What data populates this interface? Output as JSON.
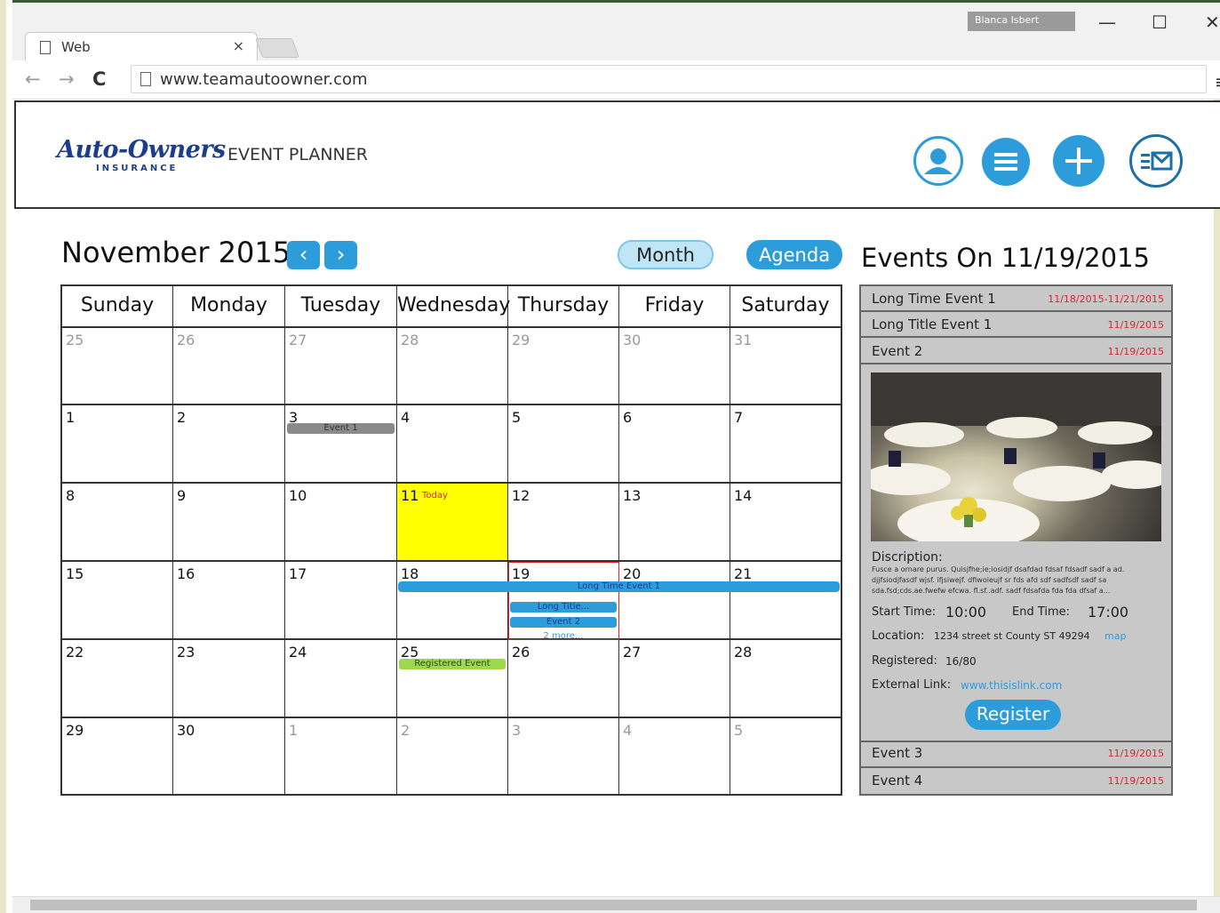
{
  "browser": {
    "tab_title": "Web",
    "tab_close": "×",
    "user_badge": "Blanca Isbert",
    "minimize": "—",
    "maximize": "☐",
    "close": "✕",
    "url": "www.teamautoowner.com",
    "back": "←",
    "forward": "→",
    "reload": "C",
    "menu": "≡"
  },
  "header": {
    "brand": "Auto-Owners",
    "brand_sub": "INSURANCE",
    "product": "EVENT PLANNER",
    "icons": [
      "user-profile-icon",
      "list-menu-icon",
      "add-event-icon",
      "email-list-icon"
    ]
  },
  "calendar": {
    "month_title": "November 2015",
    "prev": "‹",
    "next": "›",
    "view_month": "Month",
    "view_agenda": "Agenda",
    "days": [
      "Sunday",
      "Monday",
      "Tuesday",
      "Wednesday",
      "Thursday",
      "Friday",
      "Saturday"
    ],
    "weeks": [
      [
        "25",
        "26",
        "27",
        "28",
        "29",
        "30",
        "31"
      ],
      [
        "1",
        "2",
        "3",
        "4",
        "5",
        "6",
        "7"
      ],
      [
        "8",
        "9",
        "10",
        "11",
        "12",
        "13",
        "14"
      ],
      [
        "15",
        "16",
        "17",
        "18",
        "19",
        "20",
        "21"
      ],
      [
        "22",
        "23",
        "24",
        "25",
        "26",
        "27",
        "28"
      ],
      [
        "29",
        "30",
        "1",
        "2",
        "3",
        "4",
        "5"
      ]
    ],
    "today_label": "Today",
    "events": {
      "event1": "Event 1",
      "long_time": "Long Time Event 1",
      "long_title": "Long Title...",
      "event2": "Event 2",
      "more": "2 more...",
      "registered": "Registered Event"
    },
    "colors": {
      "accent": "#2d9cdb",
      "today": "#ffff00",
      "registered": "#9ed84b",
      "event_gray": "#8a8a8a"
    }
  },
  "events_panel": {
    "title": "Events On 11/19/2015",
    "items": [
      {
        "name": "Long Time Event 1",
        "date": "11/18/2015-11/21/2015"
      },
      {
        "name": "Long Title Event 1",
        "date": "11/19/2015"
      },
      {
        "name": "Event 2",
        "date": "11/19/2015"
      },
      {
        "name": "Event 3",
        "date": "11/19/2015"
      },
      {
        "name": "Event 4",
        "date": "11/19/2015"
      }
    ],
    "detail": {
      "description_label": "Discription:",
      "description_text": "Fusce a ornare purus. Quisjfhe;ie;iosidjf dsafdad fdsaf fdsadf sadf a ad. djjfsiodjfasdf wjsf. ifjsiwejf. dfiwoieujf sr fds afd sdf sadfsdf sadf sa sda.fsd;cds.ae.fwefw efcwa. fl.sf..adf. sadf fdsafda fda fda dfsaf a...",
      "start_label": "Start Time:",
      "start_value": "10:00",
      "end_label": "End Time:",
      "end_value": "17:00",
      "location_label": "Location:",
      "location_value": "1234 street st County ST 49294",
      "location_link": "map",
      "registered_label": "Registered:",
      "registered_value": "16/80",
      "external_label": "External Link:",
      "external_value": "www.thisislink.com",
      "register_button": "Register"
    }
  }
}
